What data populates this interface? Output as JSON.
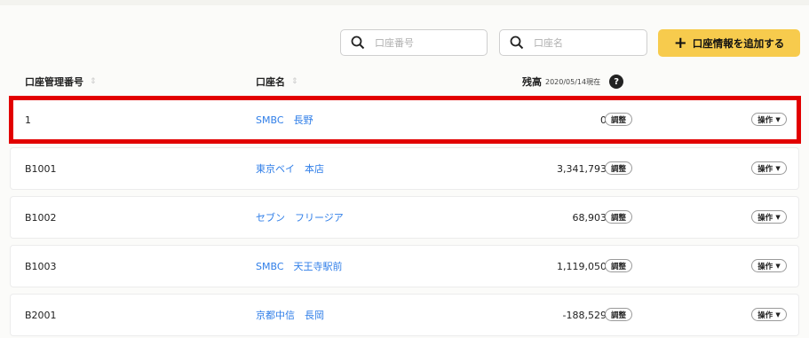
{
  "search": {
    "account_number_placeholder": "口座番号",
    "account_name_placeholder": "口座名"
  },
  "toolbar": {
    "add_label": "口座情報を追加する"
  },
  "table": {
    "headers": {
      "account_number": "口座管理番号",
      "account_name": "口座名",
      "balance": "残高",
      "balance_as_of": "2020/05/14現在"
    },
    "help_label": "?",
    "adjust_label": "調整",
    "operation_label": "操作",
    "rows": [
      {
        "number": "1",
        "name": "SMBC　長野",
        "balance": "0"
      },
      {
        "number": "B1001",
        "name": "東京ベイ　本店",
        "balance": "3,341,793"
      },
      {
        "number": "B1002",
        "name": "セブン　フリージア",
        "balance": "68,903"
      },
      {
        "number": "B1003",
        "name": "SMBC　天王寺駅前",
        "balance": "1,119,050"
      },
      {
        "number": "B2001",
        "name": "京都中信　長岡",
        "balance": "-188,529"
      }
    ]
  },
  "colors": {
    "accent": "#f7cb4d",
    "link": "#2f7ee8",
    "highlight": "#e20000"
  }
}
